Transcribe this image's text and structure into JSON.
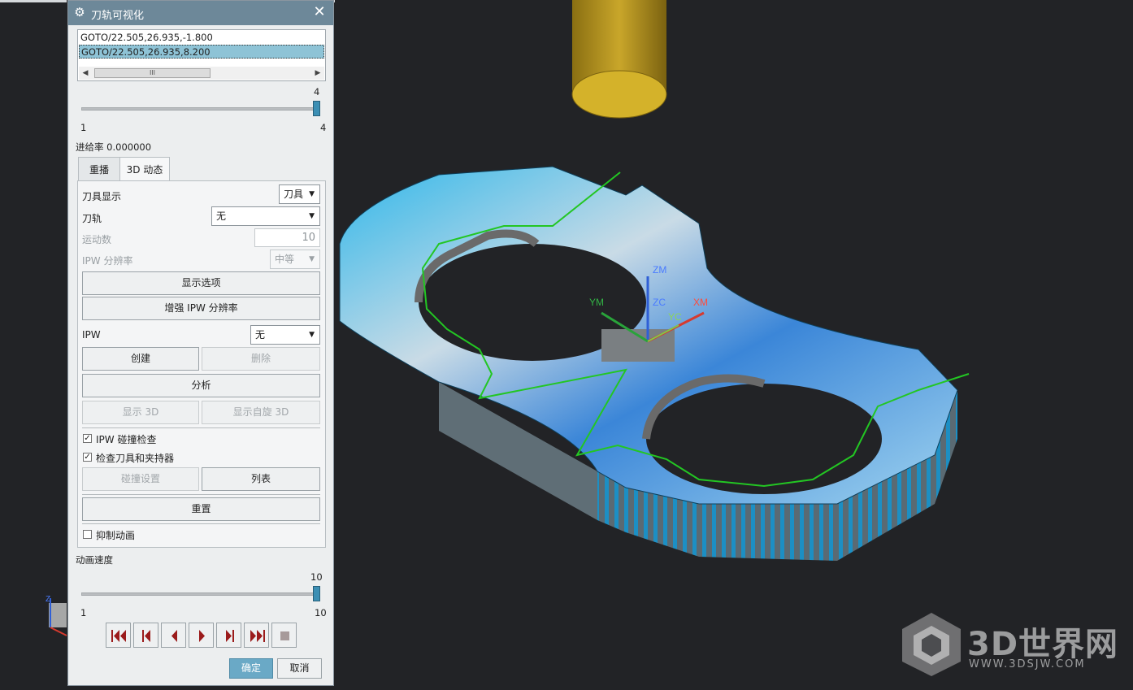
{
  "dialog": {
    "title": "刀轨可视化",
    "list_items": [
      "GOTO/22.505,26.935,-1.800",
      "GOTO/22.505,26.935,8.200"
    ],
    "scroll_thumb": "III",
    "slider_current": "4",
    "slider_min": "1",
    "slider_max": "4",
    "feed_rate": "进给率 0.000000"
  },
  "tabs": [
    {
      "label": "重播",
      "active": false
    },
    {
      "label": "3D 动态",
      "active": true
    }
  ],
  "dynamic": {
    "tool_display_label": "刀具显示",
    "tool_display_value": "刀具",
    "toolpath_label": "刀轨",
    "toolpath_value": "无",
    "motion_count_label": "运动数",
    "motion_count_value": "10",
    "ipw_res_label": "IPW 分辨率",
    "ipw_res_value": "中等",
    "display_options_button": "显示选项",
    "enhance_ipw_button": "增强 IPW 分辨率",
    "ipw_label": "IPW",
    "ipw_value": "无",
    "create_button": "创建",
    "delete_button": "删除",
    "analyze_button": "分析",
    "show3d_button": "显示 3D",
    "show_spin3d_button": "显示自旋 3D",
    "ipw_collision_check": "IPW 碰撞检查",
    "ipw_collision_checked": true,
    "check_tool_holder": "检查刀具和夹持器",
    "check_tool_holder_checked": true,
    "collision_settings_button": "碰撞设置",
    "list_button": "列表",
    "reset_button": "重置",
    "suppress_animation": "抑制动画",
    "suppress_animation_checked": false
  },
  "animation": {
    "speed_label": "动画速度",
    "speed_current": "10",
    "speed_min": "1",
    "speed_max": "10"
  },
  "playback": [
    "rewind-to-start",
    "step-back",
    "play-reverse",
    "play-forward",
    "step-forward",
    "fast-forward",
    "stop"
  ],
  "footer": {
    "ok_button": "确定",
    "cancel_button": "取消"
  },
  "viewport": {
    "axis_labels": {
      "zm": "ZM",
      "zc": "ZC",
      "ym": "YM",
      "yc": "YC",
      "xm": "XM"
    },
    "triad_z": "Z"
  },
  "watermark": {
    "brand": "3D世界网",
    "url": "WWW.3DSJW.COM"
  },
  "colors": {
    "titlebar": "#6d8899",
    "accent": "#3c8fb4",
    "part_blue": "#2bb3e8",
    "toolpath": "#23c623",
    "tool": "#c9a62a"
  }
}
